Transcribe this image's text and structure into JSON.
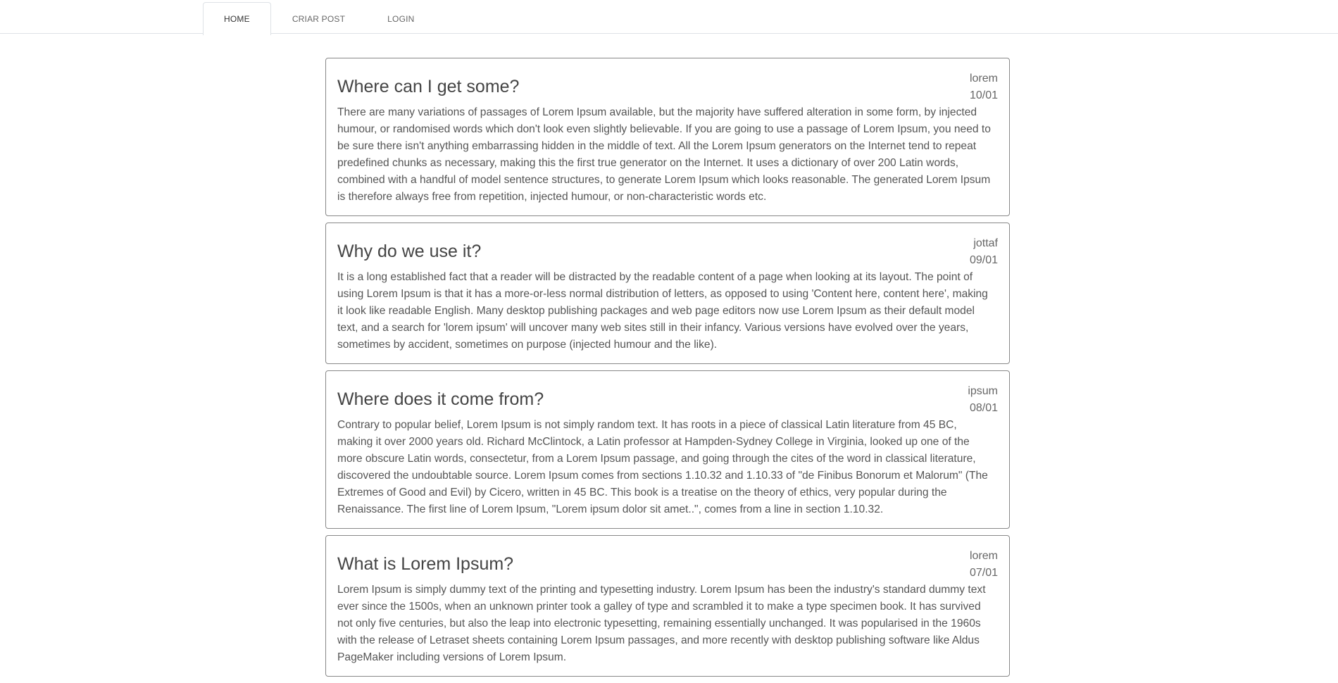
{
  "nav": {
    "tabs": [
      {
        "label": "HOME",
        "active": true
      },
      {
        "label": "CRIAR POST",
        "active": false
      },
      {
        "label": "LOGIN",
        "active": false
      }
    ]
  },
  "posts": [
    {
      "title": "Where can I get some?",
      "author": "lorem",
      "date": "10/01",
      "body": "There are many variations of passages of Lorem Ipsum available, but the majority have suffered alteration in some form, by injected humour, or randomised words which don't look even slightly believable. If you are going to use a passage of Lorem Ipsum, you need to be sure there isn't anything embarrassing hidden in the middle of text. All the Lorem Ipsum generators on the Internet tend to repeat predefined chunks as necessary, making this the first true generator on the Internet. It uses a dictionary of over 200 Latin words, combined with a handful of model sentence structures, to generate Lorem Ipsum which looks reasonable. The generated Lorem Ipsum is therefore always free from repetition, injected humour, or non-characteristic words etc."
    },
    {
      "title": "Why do we use it?",
      "author": "jottaf",
      "date": "09/01",
      "body": "It is a long established fact that a reader will be distracted by the readable content of a page when looking at its layout. The point of using Lorem Ipsum is that it has a more-or-less normal distribution of letters, as opposed to using 'Content here, content here', making it look like readable English. Many desktop publishing packages and web page editors now use Lorem Ipsum as their default model text, and a search for 'lorem ipsum' will uncover many web sites still in their infancy. Various versions have evolved over the years, sometimes by accident, sometimes on purpose (injected humour and the like)."
    },
    {
      "title": "Where does it come from?",
      "author": "ipsum",
      "date": "08/01",
      "body": "Contrary to popular belief, Lorem Ipsum is not simply random text. It has roots in a piece of classical Latin literature from 45 BC, making it over 2000 years old. Richard McClintock, a Latin professor at Hampden-Sydney College in Virginia, looked up one of the more obscure Latin words, consectetur, from a Lorem Ipsum passage, and going through the cites of the word in classical literature, discovered the undoubtable source. Lorem Ipsum comes from sections 1.10.32 and 1.10.33 of \"de Finibus Bonorum et Malorum\" (The Extremes of Good and Evil) by Cicero, written in 45 BC. This book is a treatise on the theory of ethics, very popular during the Renaissance. The first line of Lorem Ipsum, \"Lorem ipsum dolor sit amet..\", comes from a line in section 1.10.32."
    },
    {
      "title": "What is Lorem Ipsum?",
      "author": "lorem",
      "date": "07/01",
      "body": "Lorem Ipsum is simply dummy text of the printing and typesetting industry. Lorem Ipsum has been the industry's standard dummy text ever since the 1500s, when an unknown printer took a galley of type and scrambled it to make a type specimen book. It has survived not only five centuries, but also the leap into electronic typesetting, remaining essentially unchanged. It was popularised in the 1960s with the release of Letraset sheets containing Lorem Ipsum passages, and more recently with desktop publishing software like Aldus PageMaker including versions of Lorem Ipsum."
    }
  ]
}
